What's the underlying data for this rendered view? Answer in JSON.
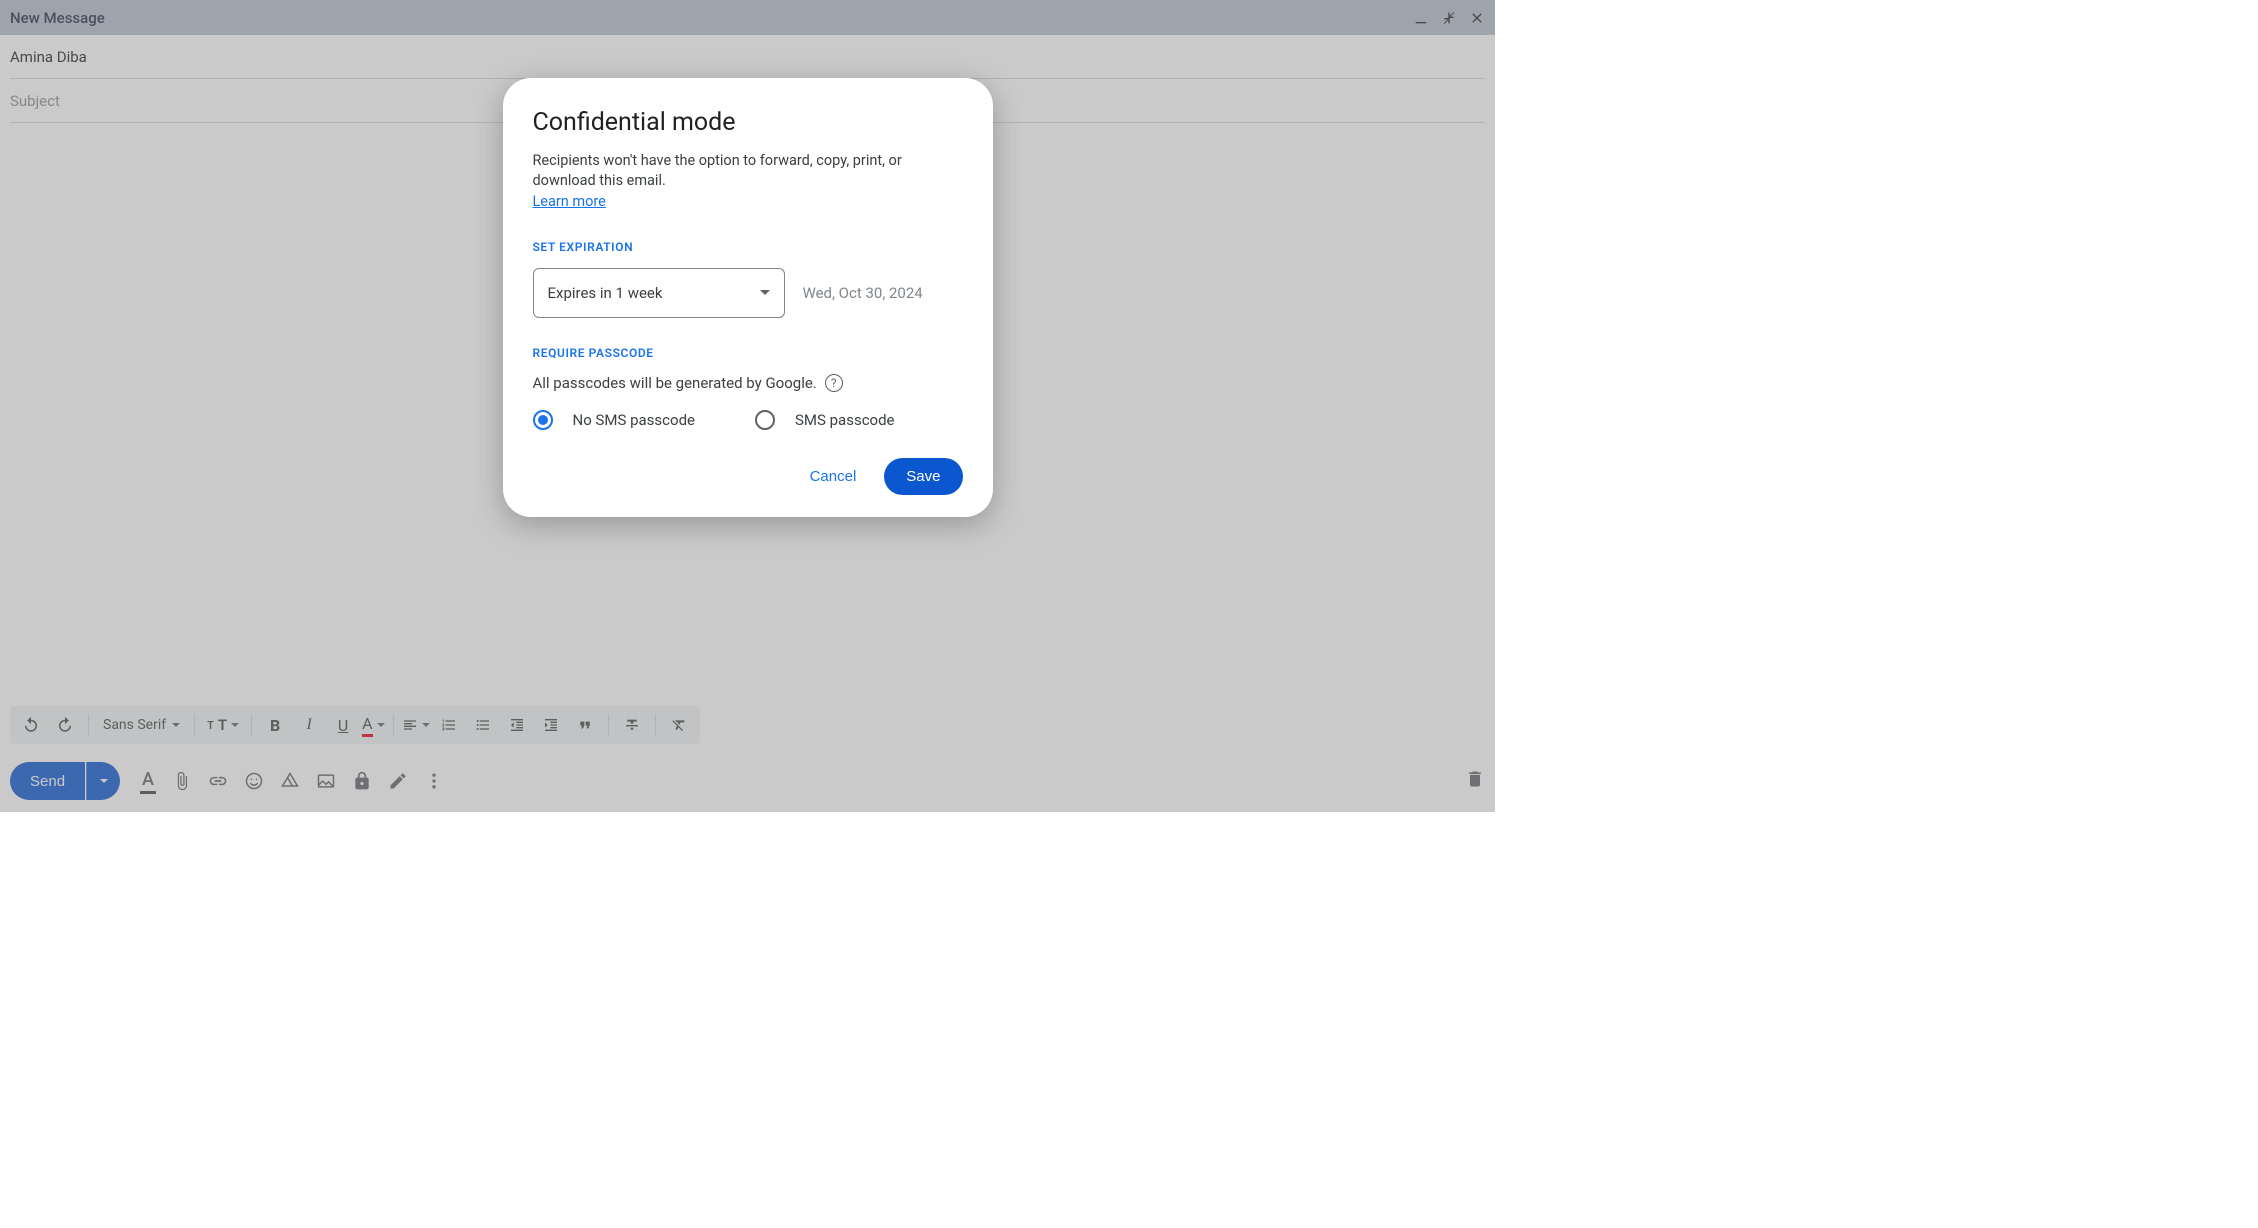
{
  "compose": {
    "title": "New Message",
    "recipient": "Amina Diba",
    "subject_placeholder": "Subject",
    "font": "Sans Serif",
    "send_label": "Send"
  },
  "dialog": {
    "title": "Confidential mode",
    "description": "Recipients won't have the option to forward, copy, print, or download this email.",
    "learn_more": "Learn more",
    "set_expiration_label": "SET EXPIRATION",
    "expiration_selected": "Expires in 1 week",
    "expiration_date": "Wed, Oct 30, 2024",
    "require_passcode_label": "REQUIRE PASSCODE",
    "passcode_note": "All passcodes will be generated by Google.",
    "radio_no_sms": "No SMS passcode",
    "radio_sms": "SMS passcode",
    "cancel": "Cancel",
    "save": "Save"
  }
}
